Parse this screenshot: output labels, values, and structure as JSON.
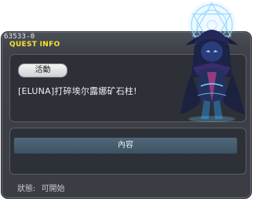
{
  "quest": {
    "id": "63533-0",
    "header_label": "QUEST INFO",
    "tag": "活動",
    "name": "[ELUNA]打碎埃尔露娜矿石柱!",
    "content_button": "內容",
    "status_label": "狀態:",
    "status_value": "可開始"
  },
  "colors": {
    "header_label": "#f7e32b",
    "window_bg": "#3a3d44",
    "panel_bg": "#2d3036",
    "button_bg": "#4b6070",
    "avatar_accent": "#7fd1ff"
  },
  "icons": {
    "avatar": "eluna-sorceress-avatar",
    "magic_circle": "magic-circle-icon"
  }
}
